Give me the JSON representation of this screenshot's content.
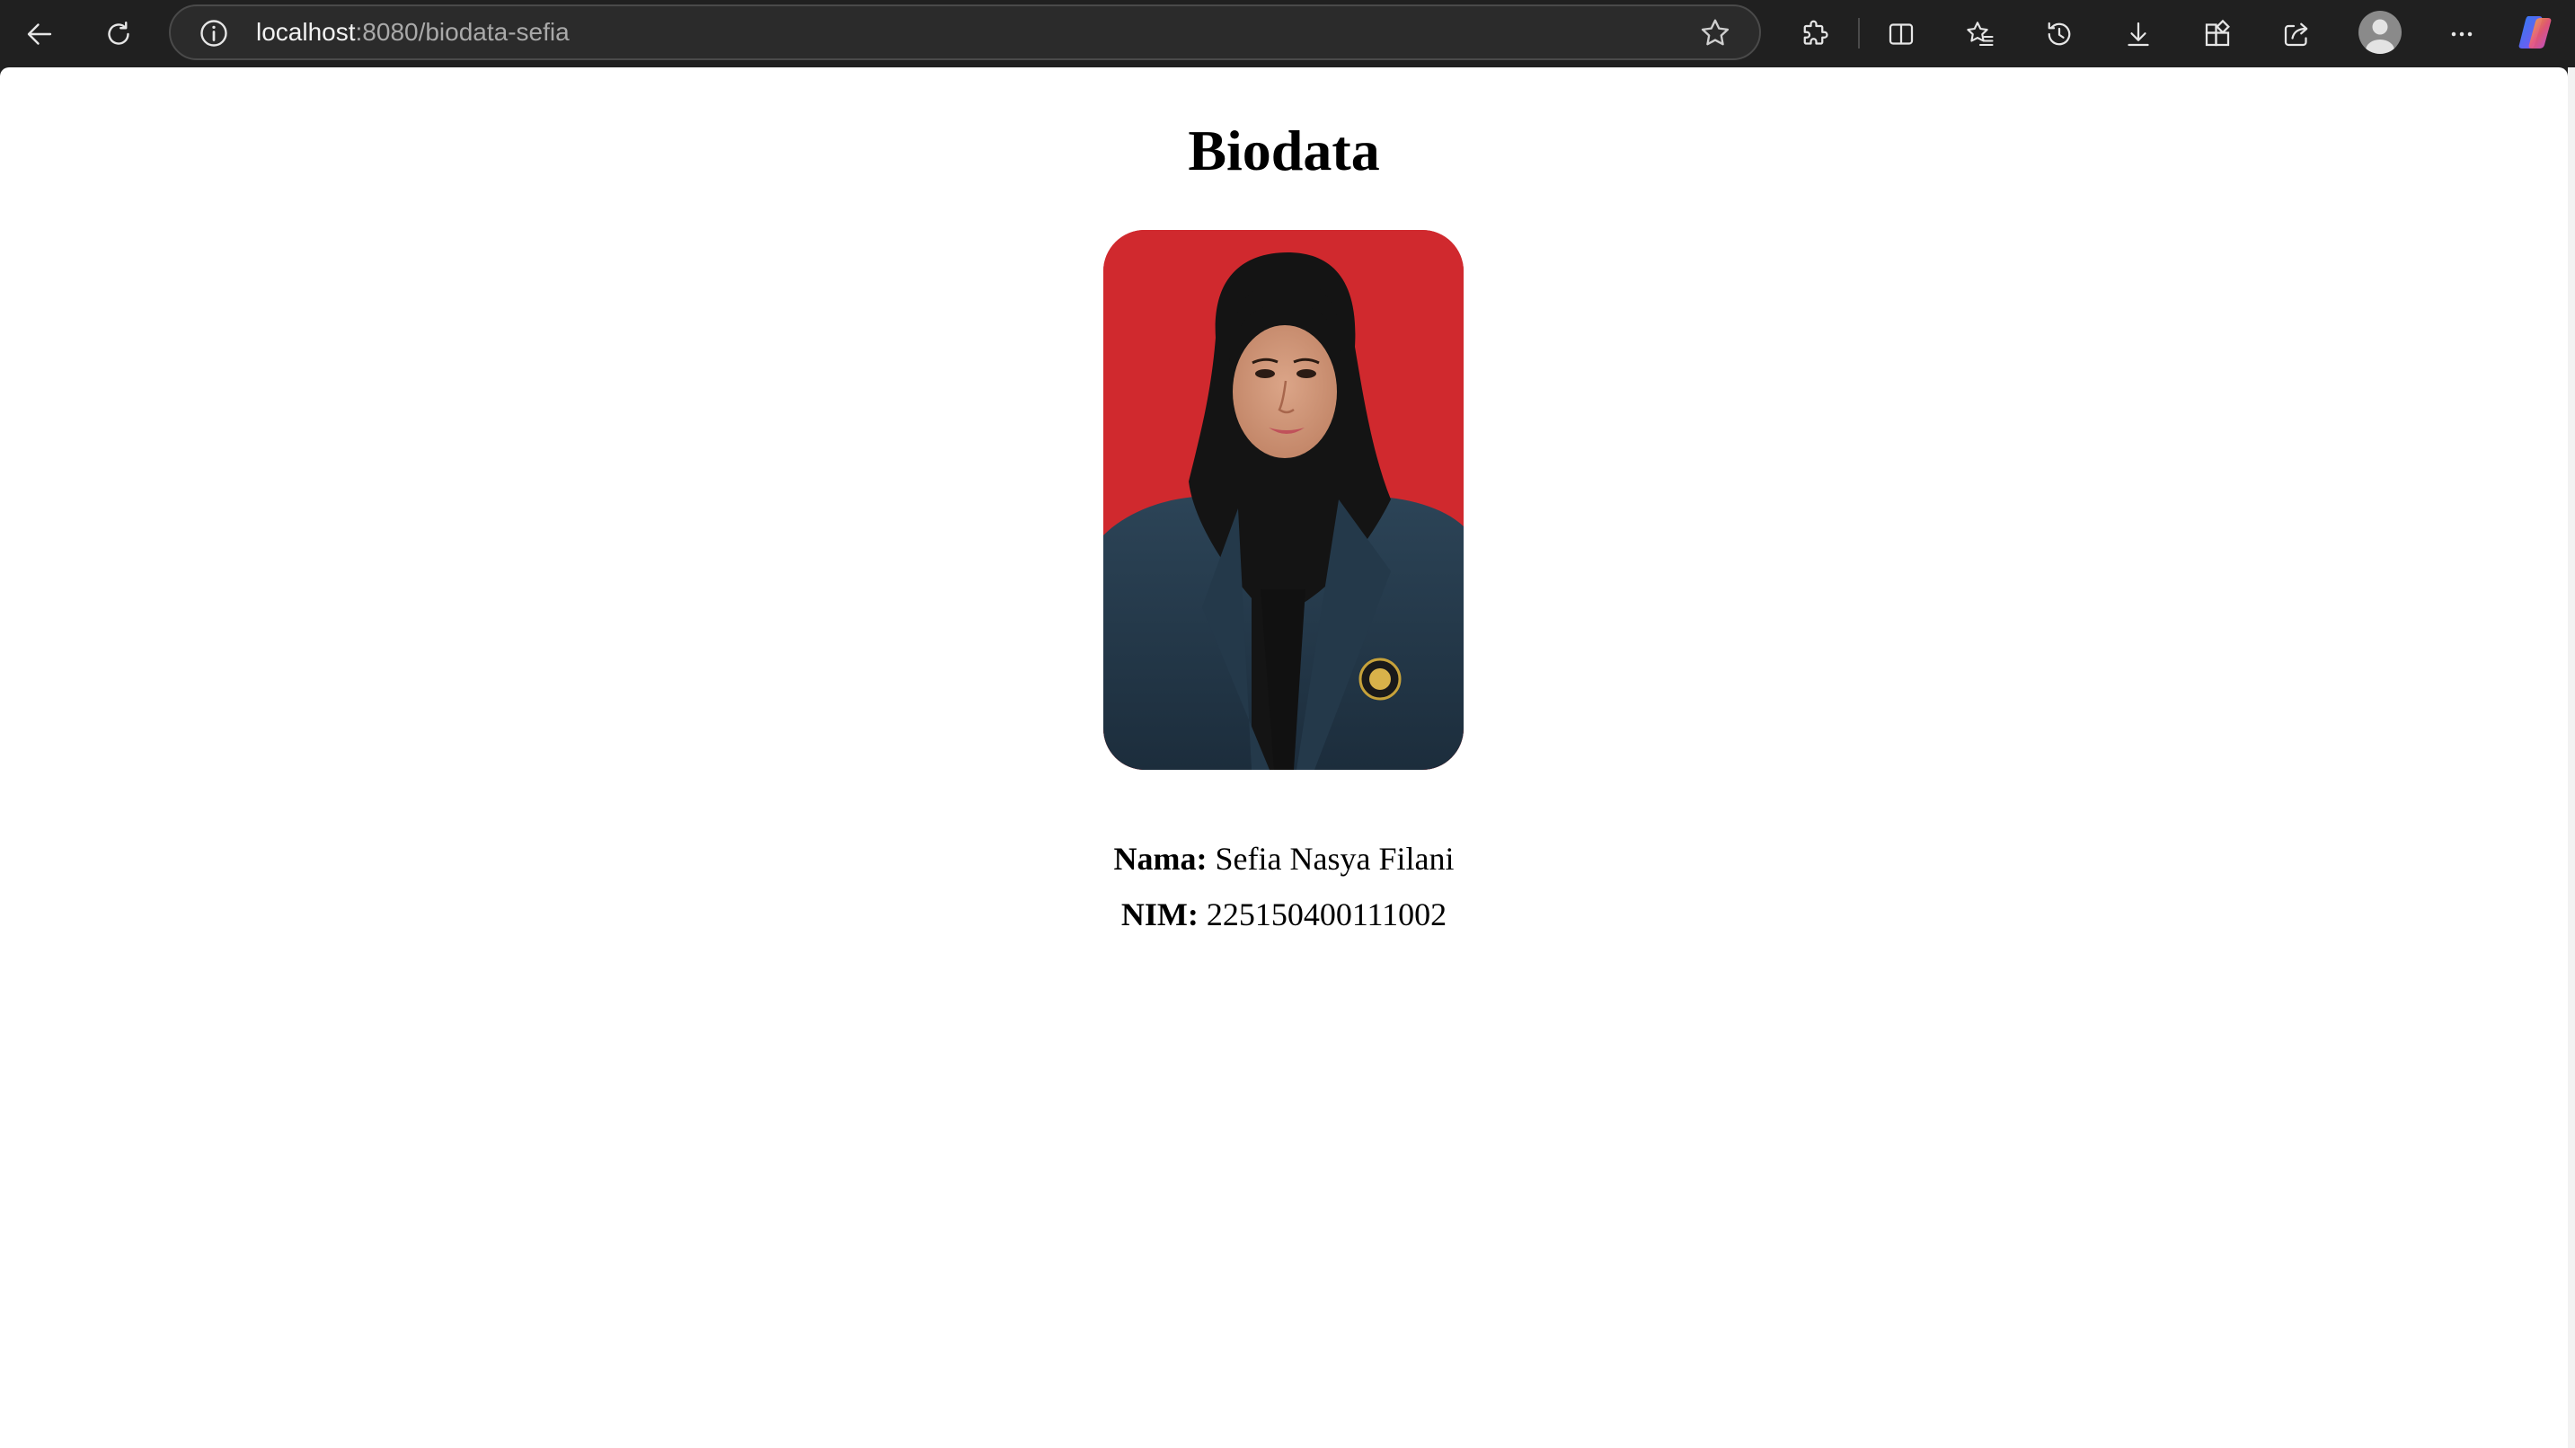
{
  "browser": {
    "url_host": "localhost",
    "url_path": ":8080/biodata-sefia"
  },
  "page": {
    "title": "Biodata",
    "name_label": "Nama:",
    "name_value": "Sefia Nasya Filani",
    "nim_label": "NIM:",
    "nim_value": "225150400111002"
  },
  "icons": [
    "back-arrow-icon",
    "refresh-icon",
    "site-info-icon",
    "favorite-star-icon",
    "extensions-icon",
    "split-screen-icon",
    "favorites-icon",
    "history-icon",
    "downloads-icon",
    "apps-icon",
    "share-icon",
    "profile-avatar-icon",
    "more-options-icon",
    "copilot-icon"
  ],
  "colors": {
    "chrome_background": "#202020",
    "address_bar": "#2b2b2b",
    "photo_background": "#d0292e",
    "page_background": "#ffffff"
  }
}
